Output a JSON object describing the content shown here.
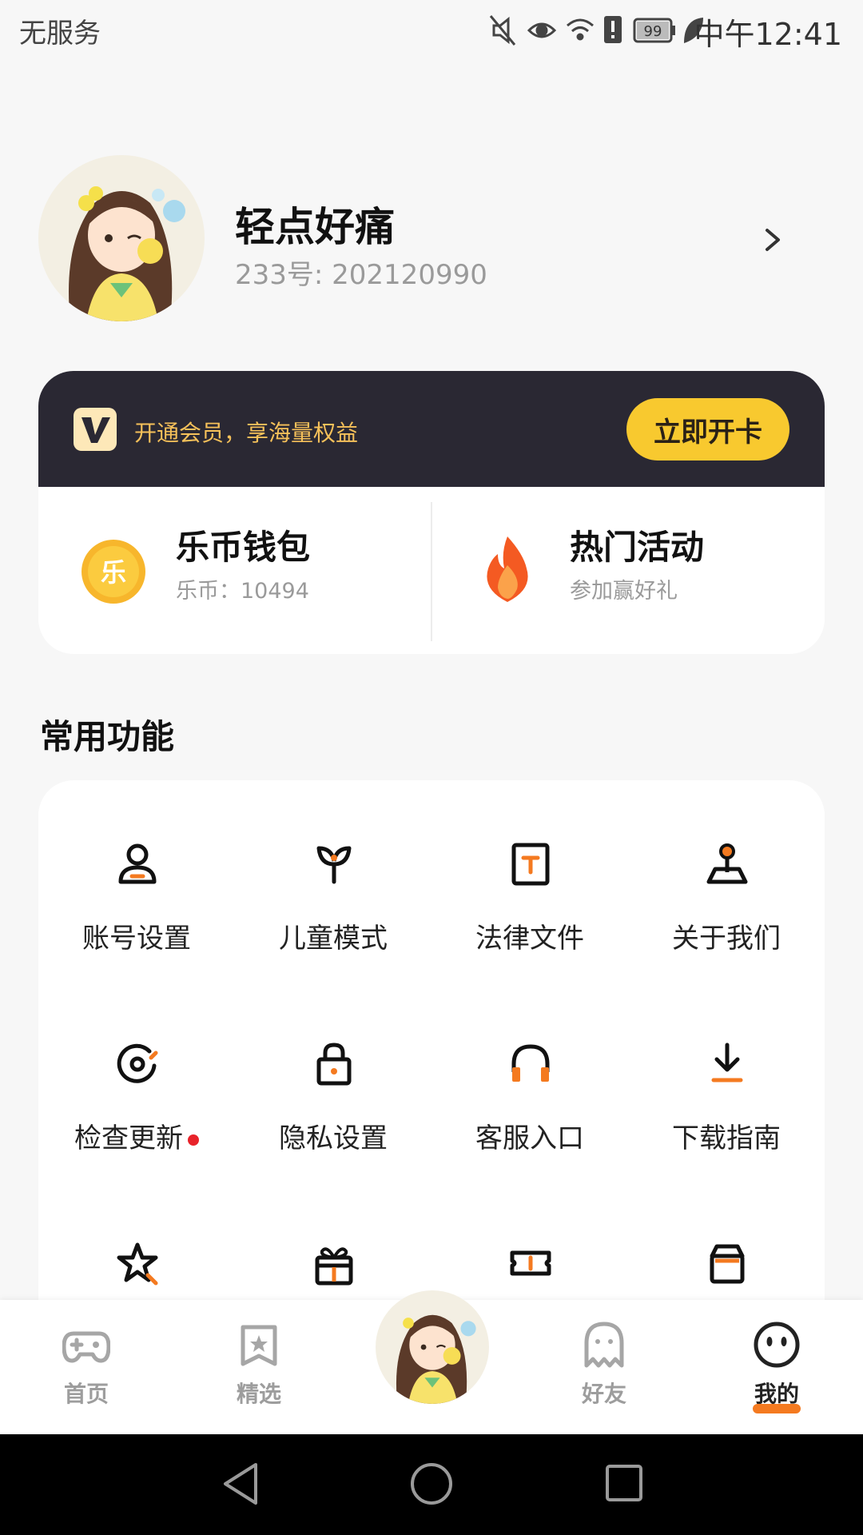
{
  "status_bar": {
    "carrier": "无服务",
    "battery": "99",
    "time": "中午12:41"
  },
  "profile": {
    "name": "轻点好痛",
    "id_text": "233号: 202120990"
  },
  "vip": {
    "text": "开通会员，享海量权益",
    "button": "立即开卡"
  },
  "wallet": {
    "title": "乐币钱包",
    "subtitle": "乐币：10494",
    "coin_glyph": "乐"
  },
  "activity": {
    "title": "热门活动",
    "subtitle": "参加赢好礼"
  },
  "section_title": "常用功能",
  "functions": [
    {
      "label": "账号设置",
      "icon": "user-icon"
    },
    {
      "label": "儿童模式",
      "icon": "sprout-icon"
    },
    {
      "label": "法律文件",
      "icon": "document-icon"
    },
    {
      "label": "关于我们",
      "icon": "joystick-icon"
    },
    {
      "label": "检查更新",
      "icon": "refresh-icon",
      "badge": true
    },
    {
      "label": "隐私设置",
      "icon": "lock-icon"
    },
    {
      "label": "客服入口",
      "icon": "headset-icon"
    },
    {
      "label": "下载指南",
      "icon": "download-icon"
    },
    {
      "label": "",
      "icon": "star-icon"
    },
    {
      "label": "",
      "icon": "gift-icon"
    },
    {
      "label": "",
      "icon": "ticket-icon"
    },
    {
      "label": "",
      "icon": "store-icon"
    }
  ],
  "nav": [
    {
      "label": "首页",
      "icon": "gamepad-icon"
    },
    {
      "label": "精选",
      "icon": "featured-icon"
    },
    {
      "label": "好友",
      "icon": "ghost-icon"
    },
    {
      "label": "我的",
      "icon": "face-icon",
      "active": true
    }
  ],
  "colors": {
    "accent": "#f47a20",
    "vip_bg": "#2a2833",
    "vip_button": "#f8c92f",
    "vip_text": "#f6c15a"
  }
}
